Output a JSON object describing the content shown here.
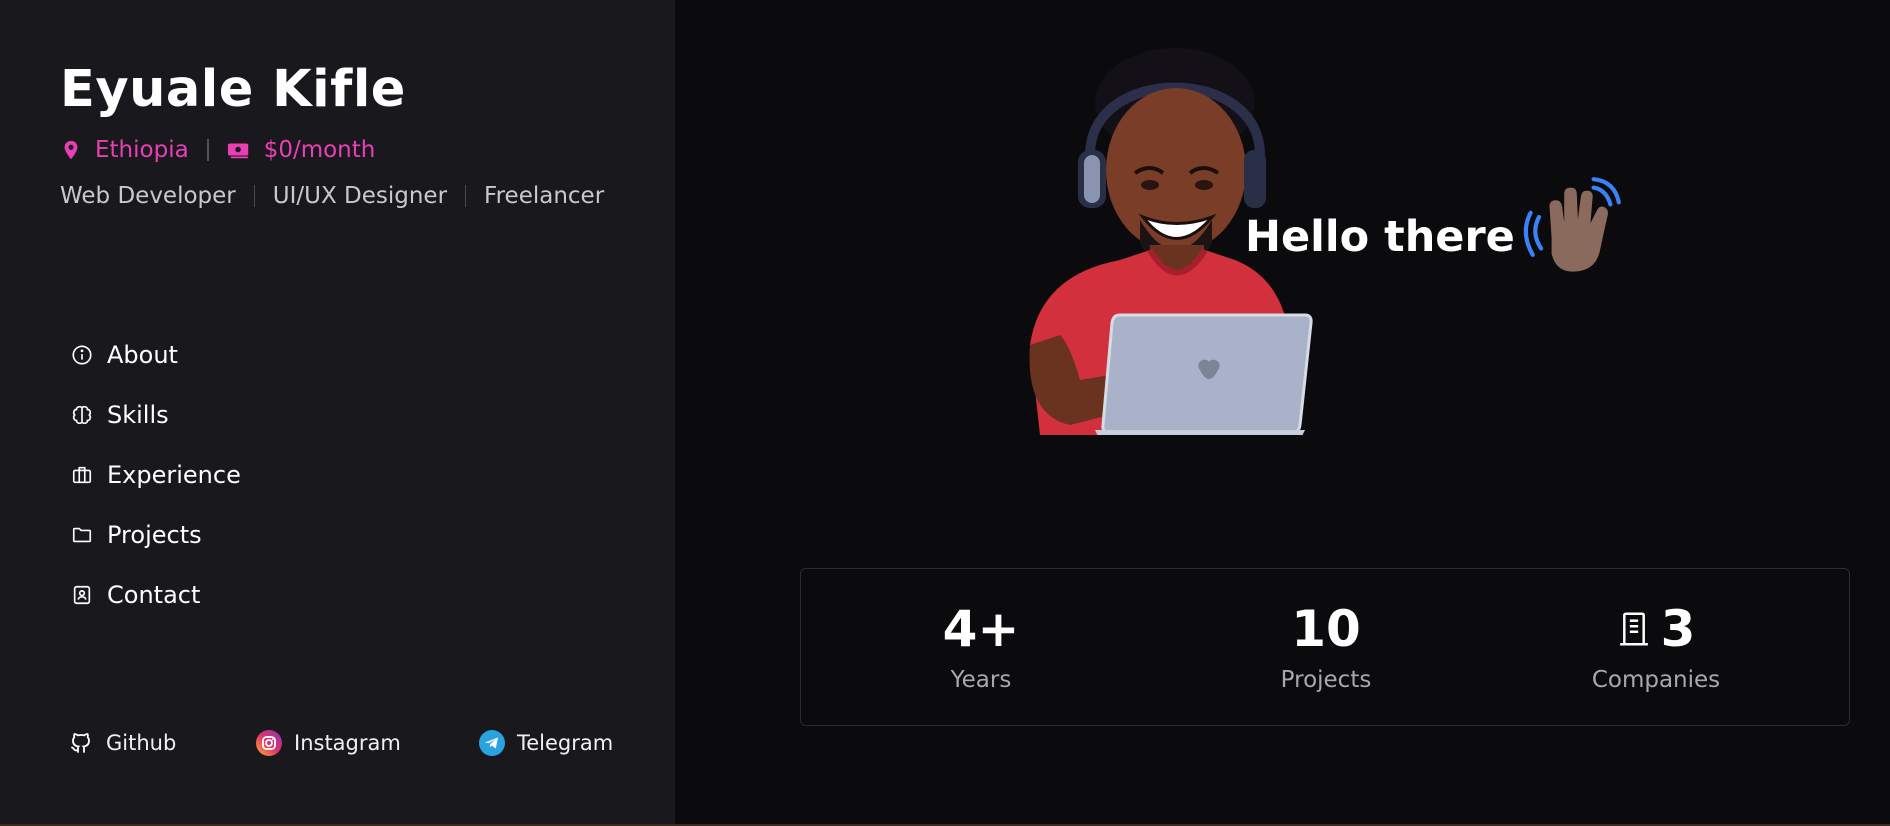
{
  "profile": {
    "name": "Eyuale Kifle",
    "location": "Ethiopia",
    "rate": "$0/month",
    "roles": [
      "Web Developer",
      "UI/UX Designer",
      "Freelancer"
    ]
  },
  "nav": {
    "items": [
      {
        "label": "About",
        "icon": "info-icon"
      },
      {
        "label": "Skills",
        "icon": "brain-icon"
      },
      {
        "label": "Experience",
        "icon": "briefcase-icon"
      },
      {
        "label": "Projects",
        "icon": "folder-icon"
      },
      {
        "label": "Contact",
        "icon": "contact-icon"
      }
    ]
  },
  "social": {
    "github": "Github",
    "instagram": "Instagram",
    "telegram": "Telegram"
  },
  "hero": {
    "greeting": "Hello there"
  },
  "stats": [
    {
      "value": "4+",
      "label": "Years"
    },
    {
      "value": "10",
      "label": "Projects"
    },
    {
      "value": "3",
      "label": "Companies"
    }
  ],
  "colors": {
    "accent": "#e93fb5",
    "sidebar_bg": "#19181c",
    "main_bg": "#0b0a0d"
  }
}
